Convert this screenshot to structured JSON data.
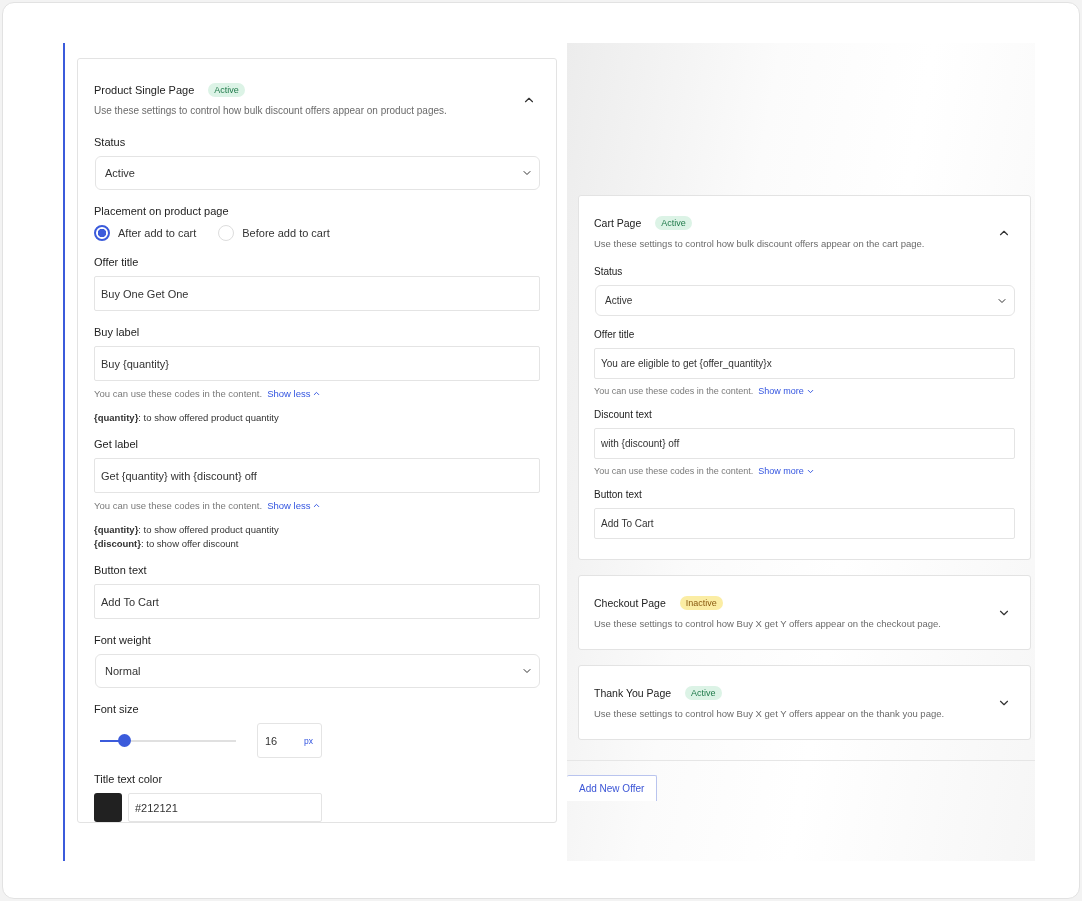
{
  "product_section": {
    "title": "Product Single Page",
    "badge": {
      "label": "Active",
      "kind": "active"
    },
    "description": "Use these settings to control how bulk discount offers appear on product pages.",
    "expanded": true,
    "fields": [
      {
        "kind": "select",
        "label": "Status",
        "value": "Active"
      },
      {
        "kind": "radio",
        "label": "Placement on product page",
        "options": [
          {
            "label": "After add to cart",
            "selected": true
          },
          {
            "label": "Before add to cart",
            "selected": false
          }
        ]
      },
      {
        "kind": "text",
        "label": "Offer title",
        "value": "Buy One Get One"
      },
      {
        "kind": "text",
        "label": "Buy label",
        "value": "Buy {quantity}",
        "help": {
          "text": "You can use these codes in the content.",
          "link": "Show less",
          "expanded": true,
          "codes": [
            "**{quantity}**: to show offered product quantity"
          ]
        }
      },
      {
        "kind": "text",
        "label": "Get label",
        "value": "Get {quantity} with {discount} off",
        "help": {
          "text": "You can use these codes in the content.",
          "link": "Show less",
          "expanded": true,
          "codes": [
            "**{quantity}**: to show offered product quantity",
            "**{discount}**: to show offer discount"
          ]
        }
      },
      {
        "kind": "text",
        "label": "Button text",
        "value": "Add To Cart"
      },
      {
        "kind": "select",
        "label": "Font weight",
        "value": "Normal"
      },
      {
        "kind": "slider",
        "label": "Font size",
        "level": 0.18,
        "value": "16",
        "unit": "px"
      },
      {
        "kind": "color",
        "label": "Title text color",
        "color": "#212121",
        "value": "#212121"
      }
    ]
  },
  "page_sections": [
    {
      "title": "Cart Page",
      "badge": {
        "label": "Active",
        "kind": "active"
      },
      "description": "Use these settings to control how bulk discount offers appear on the cart page.",
      "expanded": true,
      "fields": [
        {
          "kind": "select",
          "label": "Status",
          "value": "Active"
        },
        {
          "kind": "text",
          "label": "Offer title",
          "value": "You are eligible to get {offer_quantity}x",
          "help": {
            "text": "You can use these codes in the content.",
            "link": "Show more",
            "expanded": false
          }
        },
        {
          "kind": "text",
          "label": "Discount text",
          "value": "with {discount} off",
          "help": {
            "text": "You can use these codes in the content.",
            "link": "Show more",
            "expanded": false
          }
        },
        {
          "kind": "text",
          "label": "Button text",
          "value": "Add To Cart"
        }
      ]
    },
    {
      "title": "Checkout Page",
      "badge": {
        "label": "Inactive",
        "kind": "inactive"
      },
      "description": "Use these settings to control how Buy X get Y offers appear on the checkout page.",
      "expanded": false
    },
    {
      "title": "Thank You Page",
      "badge": {
        "label": "Active",
        "kind": "active"
      },
      "description": "Use these settings to control how Buy X get Y offers appear on the thank you page.",
      "expanded": false
    }
  ],
  "add_button": "Add New Offer"
}
